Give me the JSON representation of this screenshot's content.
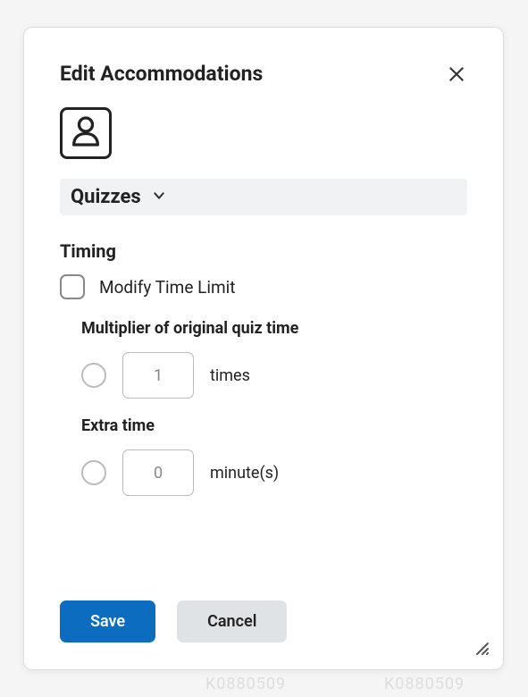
{
  "backdrop": {
    "text1": "K0880509",
    "text2": "K0880509"
  },
  "modal": {
    "title": "Edit Accommodations",
    "section_label": "Quizzes",
    "timing": {
      "heading": "Timing",
      "modify_label": "Modify Time Limit",
      "multiplier": {
        "label": "Multiplier of original quiz time",
        "value": "1",
        "unit": "times"
      },
      "extra_time": {
        "label": "Extra time",
        "value": "0",
        "unit": "minute(s)"
      }
    },
    "footer": {
      "save": "Save",
      "cancel": "Cancel"
    }
  }
}
